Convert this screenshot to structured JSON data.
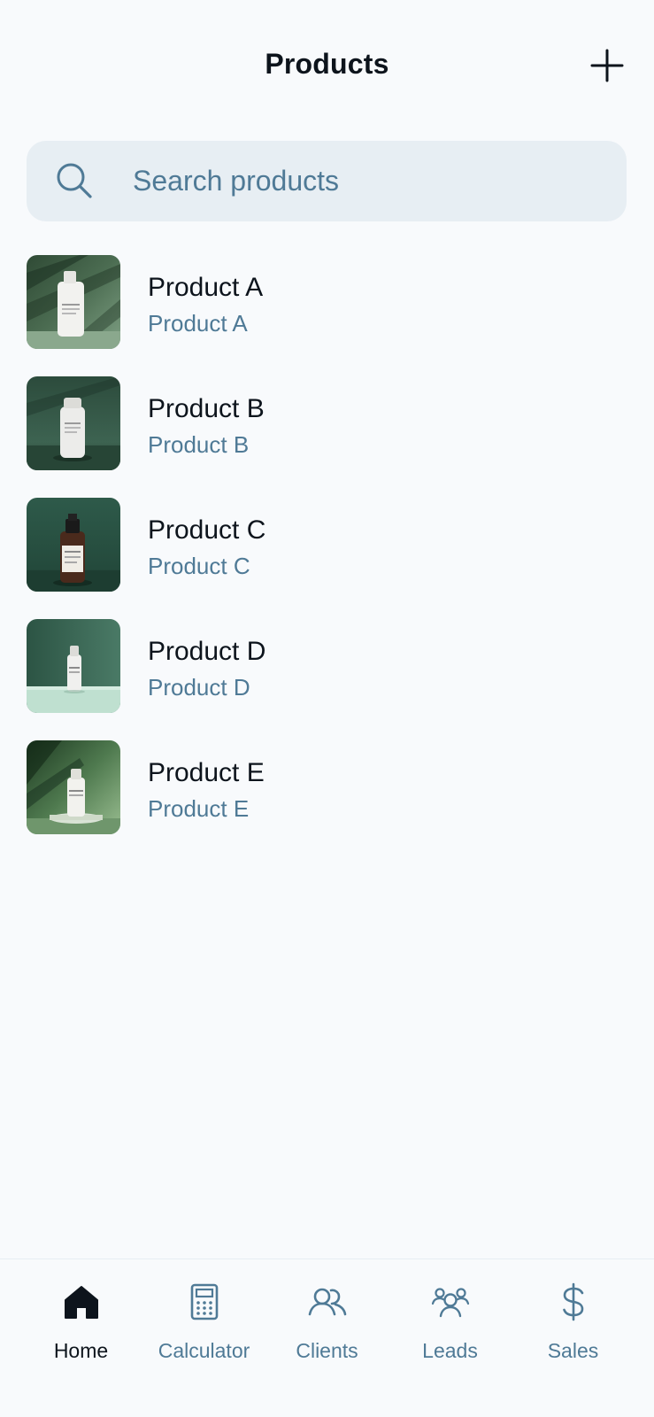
{
  "header": {
    "title": "Products",
    "add_icon": "plus-icon"
  },
  "search": {
    "placeholder": "Search products",
    "value": "",
    "icon": "search-icon"
  },
  "products": [
    {
      "name": "Product A",
      "subtitle": "Product A"
    },
    {
      "name": "Product B",
      "subtitle": "Product B"
    },
    {
      "name": "Product C",
      "subtitle": "Product C"
    },
    {
      "name": "Product D",
      "subtitle": "Product D"
    },
    {
      "name": "Product E",
      "subtitle": "Product E"
    }
  ],
  "nav": {
    "items": [
      {
        "label": "Home",
        "icon": "home-icon",
        "active": true
      },
      {
        "label": "Calculator",
        "icon": "calculator-icon",
        "active": false
      },
      {
        "label": "Clients",
        "icon": "users-icon",
        "active": false
      },
      {
        "label": "Leads",
        "icon": "group-icon",
        "active": false
      },
      {
        "label": "Sales",
        "icon": "dollar-icon",
        "active": false
      }
    ]
  },
  "colors": {
    "background": "#f8fafc",
    "search_bg": "#e7eef3",
    "text_primary": "#0d141c",
    "text_secondary": "#4f7a96"
  }
}
